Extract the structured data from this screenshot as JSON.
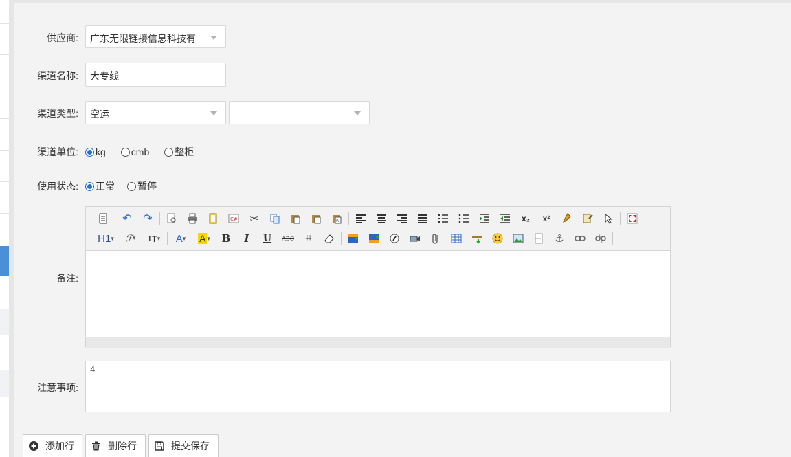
{
  "form": {
    "supplier": {
      "label": "供应商:",
      "value": "广东无限链接信息科技有"
    },
    "channel_name": {
      "label": "渠道名称:",
      "value": "大专线"
    },
    "channel_type": {
      "label": "渠道类型:",
      "value": "空运",
      "sub_value": ""
    },
    "channel_unit": {
      "label": "渠道单位:",
      "options": [
        "kg",
        "cmb",
        "整柜"
      ],
      "selected": "kg"
    },
    "status": {
      "label": "使用状态:",
      "options": [
        "正常",
        "暂停"
      ],
      "selected": "正常"
    },
    "remark": {
      "label": "备注:",
      "value": ""
    },
    "notes": {
      "label": "注意事项:",
      "value": "4"
    }
  },
  "editor_toolbar": {
    "heading": "H1",
    "bold": "B",
    "italic": "I",
    "underline": "U",
    "strike": "ABC",
    "subscript": "x₂",
    "superscript": "x²"
  },
  "buttons": {
    "add_row": "添加行",
    "delete_row": "删除行",
    "submit_save": "提交保存"
  },
  "colors": {
    "accent": "#1e6fd9",
    "sidebar_active": "#4a90d9"
  }
}
